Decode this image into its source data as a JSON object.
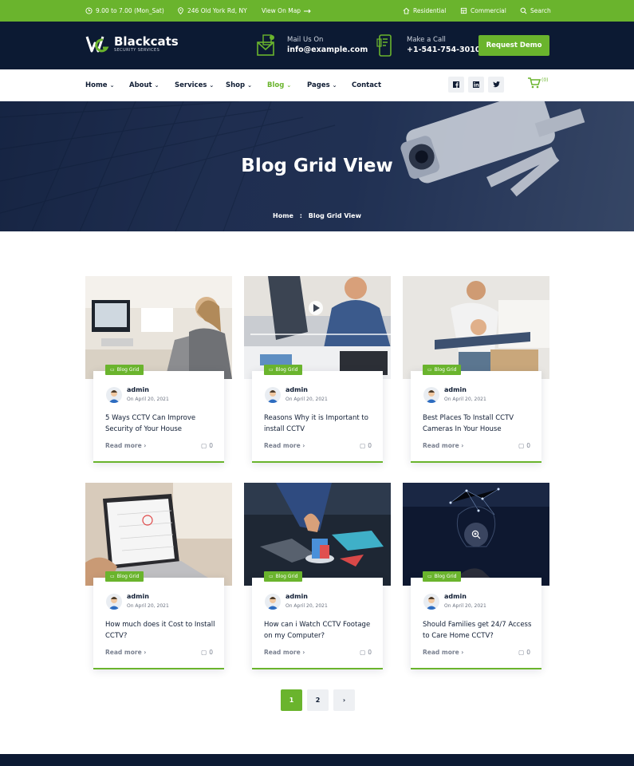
{
  "topbar": {
    "hours": "9.00 to 7.00 (Mon_Sat)",
    "address": "246 Old York Rd, NY",
    "map_link": "View On Map",
    "residential": "Residential",
    "commercial": "Commercial",
    "search": "Search"
  },
  "header": {
    "brand": "Blackcats",
    "tagline": "SECURITY SERVICES",
    "mail_label": "Mail Us On",
    "mail_value": "info@example.com",
    "call_label": "Make a Call",
    "call_value": "+1-541-754-3010",
    "demo_button": "Request Demo"
  },
  "nav": {
    "items": [
      {
        "label": "Home"
      },
      {
        "label": "About"
      },
      {
        "label": "Services"
      },
      {
        "label": "Shop"
      },
      {
        "label": "Blog"
      },
      {
        "label": "Pages"
      },
      {
        "label": "Contact"
      }
    ],
    "cart_count": "(0)"
  },
  "banner": {
    "title": "Blog Grid View",
    "crumb_home": "Home",
    "crumb_sep": ":",
    "crumb_current": "Blog Grid View"
  },
  "posts": [
    {
      "category": "Blog Grid",
      "author": "admin",
      "date": "On April 20, 2021",
      "title": "5 Ways CCTV Can Improve Security of Your House",
      "read_more": "Read more",
      "comments": "0"
    },
    {
      "category": "Blog Grid",
      "author": "admin",
      "date": "On April 20, 2021",
      "title": "Reasons Why it is Important to install CCTV",
      "read_more": "Read more",
      "comments": "0"
    },
    {
      "category": "Blog Grid",
      "author": "admin",
      "date": "On April 20, 2021",
      "title": "Best Places To Install CCTV Cameras In Your House",
      "read_more": "Read more",
      "comments": "0"
    },
    {
      "category": "Blog Grid",
      "author": "admin",
      "date": "On April 20, 2021",
      "title": "How much does it Cost to Install CCTV?",
      "read_more": "Read more",
      "comments": "0"
    },
    {
      "category": "Blog Grid",
      "author": "admin",
      "date": "On April 20, 2021",
      "title": "How can i Watch CCTV Footage on my Computer?",
      "read_more": "Read more",
      "comments": "0"
    },
    {
      "category": "Blog Grid",
      "author": "admin",
      "date": "On April 20, 2021",
      "title": "Should Families get 24/7 Access to Care Home CCTV?",
      "read_more": "Read more",
      "comments": "0"
    }
  ],
  "pagination": {
    "pages": [
      "1",
      "2"
    ],
    "next": "›",
    "current": "1"
  },
  "colors": {
    "accent": "#6ab42d",
    "navy": "#0c1a33"
  }
}
